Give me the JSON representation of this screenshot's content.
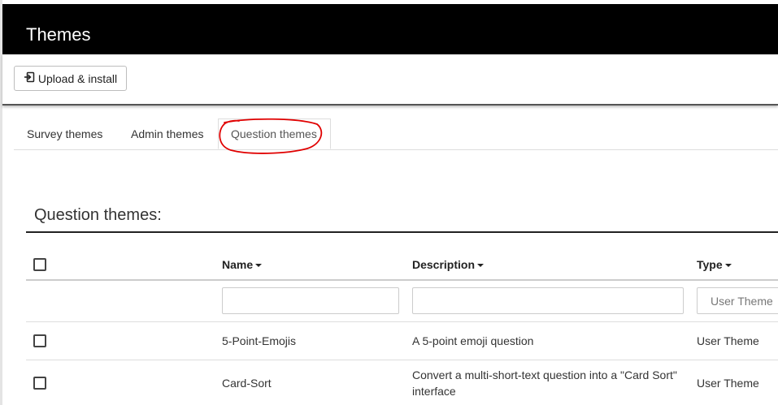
{
  "header": {
    "title": "Themes"
  },
  "toolbar": {
    "upload_label": "Upload & install"
  },
  "tabs": [
    {
      "label": "Survey themes"
    },
    {
      "label": "Admin themes"
    },
    {
      "label": "Question themes"
    }
  ],
  "section": {
    "title": "Question themes:"
  },
  "table": {
    "columns": [
      {
        "label": "Name"
      },
      {
        "label": "Description"
      },
      {
        "label": "Type"
      }
    ],
    "filters": {
      "name_value": "",
      "description_value": "",
      "type_placeholder": "User Theme"
    },
    "rows": [
      {
        "name": "5-Point-Emojis",
        "description": "A 5-point emoji question",
        "type": "User Theme"
      },
      {
        "name": "Card-Sort",
        "description": "Convert a multi-short-text question into a \"Card Sort\" interface",
        "type": "User Theme"
      }
    ]
  },
  "colors": {
    "topbar": "#000000",
    "annotation_circle": "#e00000"
  }
}
